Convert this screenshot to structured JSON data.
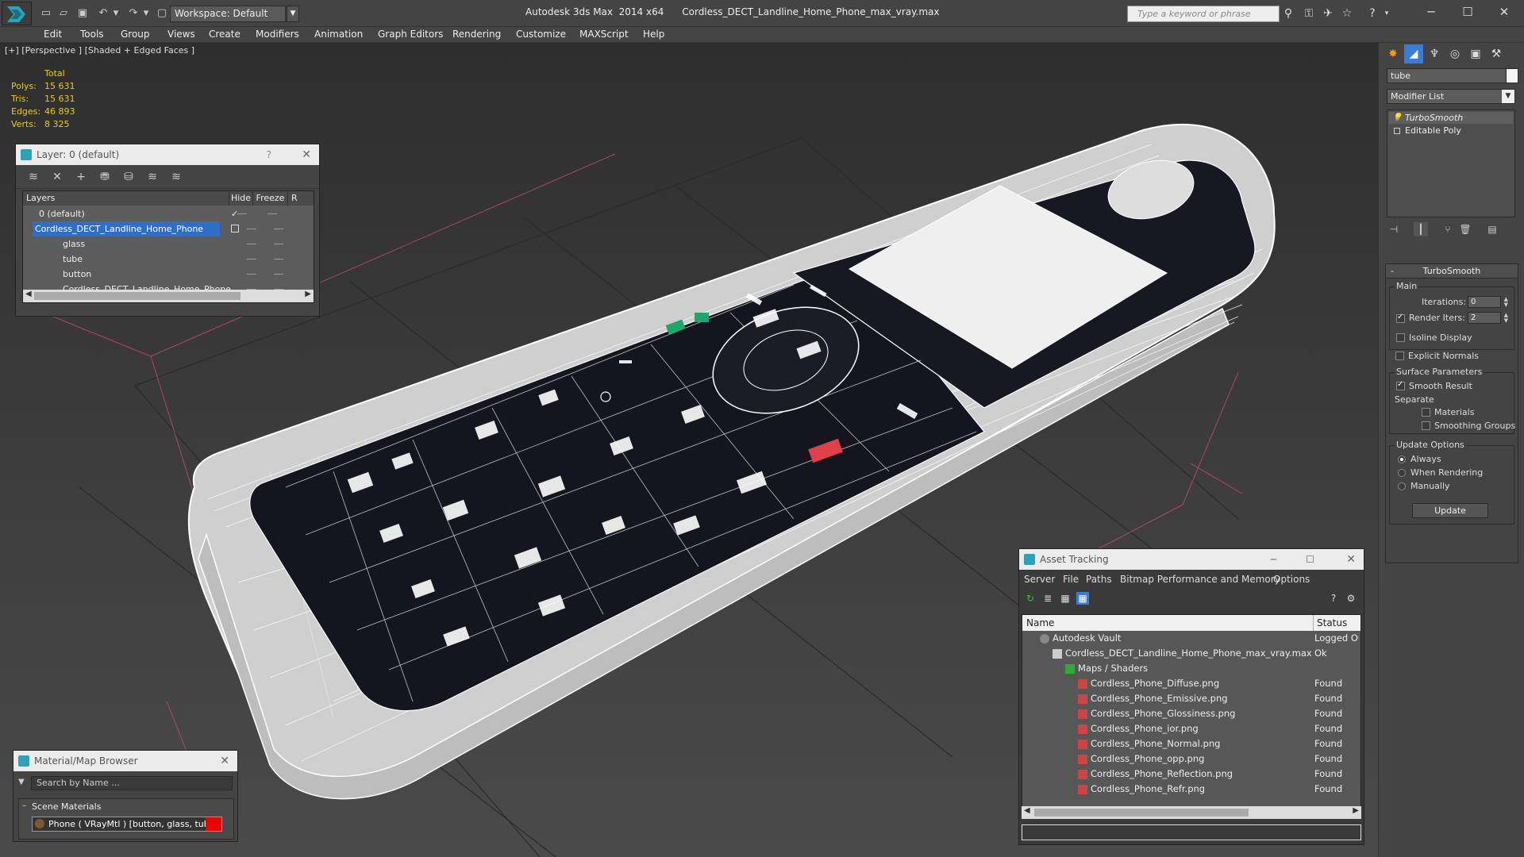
{
  "titlebar": {
    "workspace": "Workspace: Default",
    "title": "Autodesk 3ds Max  2014 x64      Cordless_DECT_Landline_Home_Phone_max_vray.max",
    "search_placeholder": "Type a keyword or phrase"
  },
  "menubar": [
    "Edit",
    "Tools",
    "Group",
    "Views",
    "Create",
    "Modifiers",
    "Animation",
    "Graph Editors",
    "Rendering",
    "Customize",
    "MAXScript",
    "Help"
  ],
  "viewport": {
    "label": "[+] [Perspective ] [Shaded + Edged Faces ]",
    "stats_header": "Total",
    "stats": [
      {
        "label": "Polys:",
        "value": "15 631"
      },
      {
        "label": "Tris:",
        "value": "15 631"
      },
      {
        "label": "Edges:",
        "value": "46 893"
      },
      {
        "label": "Verts:",
        "value": "8 325"
      }
    ]
  },
  "layer_dialog": {
    "title": "Layer: 0 (default)",
    "help": "?",
    "columns": {
      "layers": "Layers",
      "hide": "Hide",
      "freeze": "Freeze",
      "render": "R"
    },
    "rows": [
      "0 (default)",
      "Cordless_DECT_Landline_Home_Phone",
      "glass",
      "tube",
      "button",
      "Cordless_DECT_Landline_Home_Phone"
    ]
  },
  "material_browser": {
    "title": "Material/Map Browser",
    "search_placeholder": "Search by Name ...",
    "group": "Scene Materials",
    "item": "Phone ( VRayMtl ) [button, glass, tube]"
  },
  "asset_tracking": {
    "title": "Asset Tracking",
    "menu": [
      "Server",
      "File",
      "Paths",
      "Bitmap Performance and Memory",
      "Options"
    ],
    "columns": {
      "name": "Name",
      "status": "Status"
    },
    "rows": [
      {
        "name": "Autodesk Vault",
        "status": "Logged Ou"
      },
      {
        "name": "Cordless_DECT_Landline_Home_Phone_max_vray.max",
        "status": "Ok"
      },
      {
        "name": "Maps / Shaders",
        "status": ""
      },
      {
        "name": "Cordless_Phone_Diffuse.png",
        "status": "Found"
      },
      {
        "name": "Cordless_Phone_Emissive.png",
        "status": "Found"
      },
      {
        "name": "Cordless_Phone_Glossiness.png",
        "status": "Found"
      },
      {
        "name": "Cordless_Phone_ior.png",
        "status": "Found"
      },
      {
        "name": "Cordless_Phone_Normal.png",
        "status": "Found"
      },
      {
        "name": "Cordless_Phone_opp.png",
        "status": "Found"
      },
      {
        "name": "Cordless_Phone_Reflection.png",
        "status": "Found"
      },
      {
        "name": "Cordless_Phone_Refr.png",
        "status": "Found"
      }
    ]
  },
  "command_panel": {
    "object_name": "tube",
    "modifier_list": "Modifier List",
    "stack": [
      "TurboSmooth",
      "Editable Poly"
    ],
    "rollout_title": "TurboSmooth",
    "main": "Main",
    "iterations_label": "Iterations:",
    "iterations_value": "0",
    "render_iters_label": "Render Iters:",
    "render_iters_value": "2",
    "isoline": "Isoline Display",
    "explicit_normals": "Explicit Normals",
    "surface_params": "Surface Parameters",
    "smooth_result": "Smooth Result",
    "separate": "Separate",
    "materials": "Materials",
    "smoothing_groups": "Smoothing Groups",
    "update_options": "Update Options",
    "always": "Always",
    "when_rendering": "When Rendering",
    "manually": "Manually",
    "update_button": "Update"
  }
}
